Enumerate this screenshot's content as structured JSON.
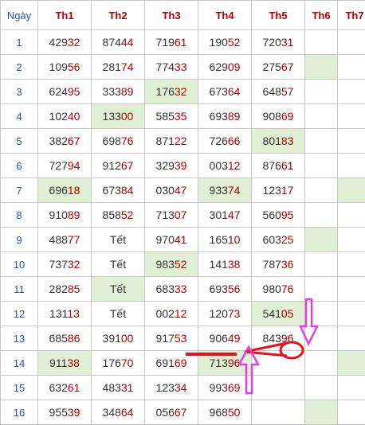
{
  "header": [
    "Ngày",
    "Th1",
    "Th2",
    "Th3",
    "Th4",
    "Th5",
    "Th6",
    "Th7"
  ],
  "rows": [
    {
      "day": "1",
      "cells": [
        {
          "n": "429",
          "t": "32"
        },
        {
          "n": "874",
          "t": "44"
        },
        {
          "n": "719",
          "t": "61"
        },
        {
          "n": "190",
          "t": "52"
        },
        {
          "n": "720",
          "t": "31"
        },
        {
          "n": "",
          "t": ""
        },
        {
          "n": "",
          "t": ""
        }
      ],
      "hl": []
    },
    {
      "day": "2",
      "cells": [
        {
          "n": "109",
          "t": "56"
        },
        {
          "n": "281",
          "t": "74"
        },
        {
          "n": "774",
          "t": "33"
        },
        {
          "n": "629",
          "t": "09"
        },
        {
          "n": "275",
          "t": "67"
        },
        {
          "n": "",
          "t": ""
        },
        {
          "n": "",
          "t": ""
        }
      ],
      "hl": [
        5
      ]
    },
    {
      "day": "3",
      "cells": [
        {
          "n": "624",
          "t": "95"
        },
        {
          "n": "333",
          "t": "89"
        },
        {
          "n": "176",
          "t": "32"
        },
        {
          "n": "673",
          "t": "64"
        },
        {
          "n": "648",
          "t": "57"
        },
        {
          "n": "",
          "t": ""
        },
        {
          "n": "",
          "t": ""
        }
      ],
      "hl": [
        2
      ]
    },
    {
      "day": "4",
      "cells": [
        {
          "n": "102",
          "t": "40"
        },
        {
          "n": "133",
          "t": "00"
        },
        {
          "n": "585",
          "t": "35"
        },
        {
          "n": "693",
          "t": "89"
        },
        {
          "n": "908",
          "t": "69"
        },
        {
          "n": "",
          "t": ""
        },
        {
          "n": "",
          "t": ""
        }
      ],
      "hl": [
        1
      ]
    },
    {
      "day": "5",
      "cells": [
        {
          "n": "382",
          "t": "67"
        },
        {
          "n": "698",
          "t": "76"
        },
        {
          "n": "871",
          "t": "22"
        },
        {
          "n": "726",
          "t": "66"
        },
        {
          "n": "801",
          "t": "83"
        },
        {
          "n": "",
          "t": ""
        },
        {
          "n": "",
          "t": ""
        }
      ],
      "hl": [
        4
      ]
    },
    {
      "day": "6",
      "cells": [
        {
          "n": "727",
          "t": "94"
        },
        {
          "n": "912",
          "t": "67"
        },
        {
          "n": "329",
          "t": "39"
        },
        {
          "n": "003",
          "t": "12"
        },
        {
          "n": "876",
          "t": "61"
        },
        {
          "n": "",
          "t": ""
        },
        {
          "n": "",
          "t": ""
        }
      ],
      "hl": []
    },
    {
      "day": "7",
      "cells": [
        {
          "n": "696",
          "t": "18"
        },
        {
          "n": "673",
          "t": "84"
        },
        {
          "n": "030",
          "t": "47"
        },
        {
          "n": "933",
          "t": "74"
        },
        {
          "n": "123",
          "t": "17"
        },
        {
          "n": "",
          "t": ""
        },
        {
          "n": "",
          "t": ""
        }
      ],
      "hl": [
        0,
        3,
        6
      ]
    },
    {
      "day": "8",
      "cells": [
        {
          "n": "910",
          "t": "89"
        },
        {
          "n": "858",
          "t": "52"
        },
        {
          "n": "713",
          "t": "07"
        },
        {
          "n": "301",
          "t": "47"
        },
        {
          "n": "560",
          "t": "95"
        },
        {
          "n": "",
          "t": ""
        },
        {
          "n": "",
          "t": ""
        }
      ],
      "hl": []
    },
    {
      "day": "9",
      "cells": [
        {
          "n": "488",
          "t": "77"
        },
        {
          "n": "Tết",
          "t": ""
        },
        {
          "n": "970",
          "t": "41"
        },
        {
          "n": "165",
          "t": "10"
        },
        {
          "n": "603",
          "t": "25"
        },
        {
          "n": "",
          "t": ""
        },
        {
          "n": "",
          "t": ""
        }
      ],
      "hl": [
        5
      ]
    },
    {
      "day": "10",
      "cells": [
        {
          "n": "737",
          "t": "32"
        },
        {
          "n": "Tết",
          "t": ""
        },
        {
          "n": "983",
          "t": "52"
        },
        {
          "n": "141",
          "t": "38"
        },
        {
          "n": "787",
          "t": "36"
        },
        {
          "n": "",
          "t": ""
        },
        {
          "n": "",
          "t": ""
        }
      ],
      "hl": [
        2
      ]
    },
    {
      "day": "11",
      "cells": [
        {
          "n": "282",
          "t": "85"
        },
        {
          "n": "Tết",
          "t": ""
        },
        {
          "n": "683",
          "t": "33"
        },
        {
          "n": "693",
          "t": "56"
        },
        {
          "n": "980",
          "t": "76"
        },
        {
          "n": "",
          "t": ""
        },
        {
          "n": "",
          "t": ""
        }
      ],
      "hl": [
        1
      ]
    },
    {
      "day": "12",
      "cells": [
        {
          "n": "131",
          "t": "13"
        },
        {
          "n": "Tết",
          "t": ""
        },
        {
          "n": "002",
          "t": "12"
        },
        {
          "n": "120",
          "t": "73"
        },
        {
          "n": "541",
          "t": "05"
        },
        {
          "n": "",
          "t": ""
        },
        {
          "n": "",
          "t": ""
        }
      ],
      "hl": [
        4
      ]
    },
    {
      "day": "13",
      "cells": [
        {
          "n": "685",
          "t": "86"
        },
        {
          "n": "391",
          "t": "00"
        },
        {
          "n": "917",
          "t": "53"
        },
        {
          "n": "906",
          "t": "49"
        },
        {
          "n": "843",
          "t": "96"
        },
        {
          "n": "",
          "t": ""
        },
        {
          "n": "",
          "t": ""
        }
      ],
      "hl": []
    },
    {
      "day": "14",
      "cells": [
        {
          "n": "911",
          "t": "38"
        },
        {
          "n": "176",
          "t": "70"
        },
        {
          "n": "691",
          "t": "69"
        },
        {
          "n": "713",
          "t": "96"
        },
        {
          "n": "",
          "t": ""
        },
        {
          "n": "",
          "t": ""
        },
        {
          "n": "",
          "t": ""
        }
      ],
      "hl": [
        0,
        3,
        6
      ]
    },
    {
      "day": "15",
      "cells": [
        {
          "n": "632",
          "t": "61"
        },
        {
          "n": "483",
          "t": "31"
        },
        {
          "n": "123",
          "t": "34"
        },
        {
          "n": "993",
          "t": "69"
        },
        {
          "n": "",
          "t": ""
        },
        {
          "n": "",
          "t": ""
        },
        {
          "n": "",
          "t": ""
        }
      ],
      "hl": []
    },
    {
      "day": "16",
      "cells": [
        {
          "n": "955",
          "t": "39"
        },
        {
          "n": "348",
          "t": "64"
        },
        {
          "n": "056",
          "t": "67"
        },
        {
          "n": "968",
          "t": "50"
        },
        {
          "n": "",
          "t": ""
        },
        {
          "n": "",
          "t": ""
        },
        {
          "n": "",
          "t": ""
        }
      ],
      "hl": [
        5
      ]
    }
  ],
  "colors": {
    "header_text": "#b30000",
    "day_text": "#2a4fb6",
    "highlight_bg": "#dff0d5",
    "tail_digits": "#b30000",
    "annotation_red": "#e8101a",
    "annotation_magenta": "#e040e0"
  }
}
